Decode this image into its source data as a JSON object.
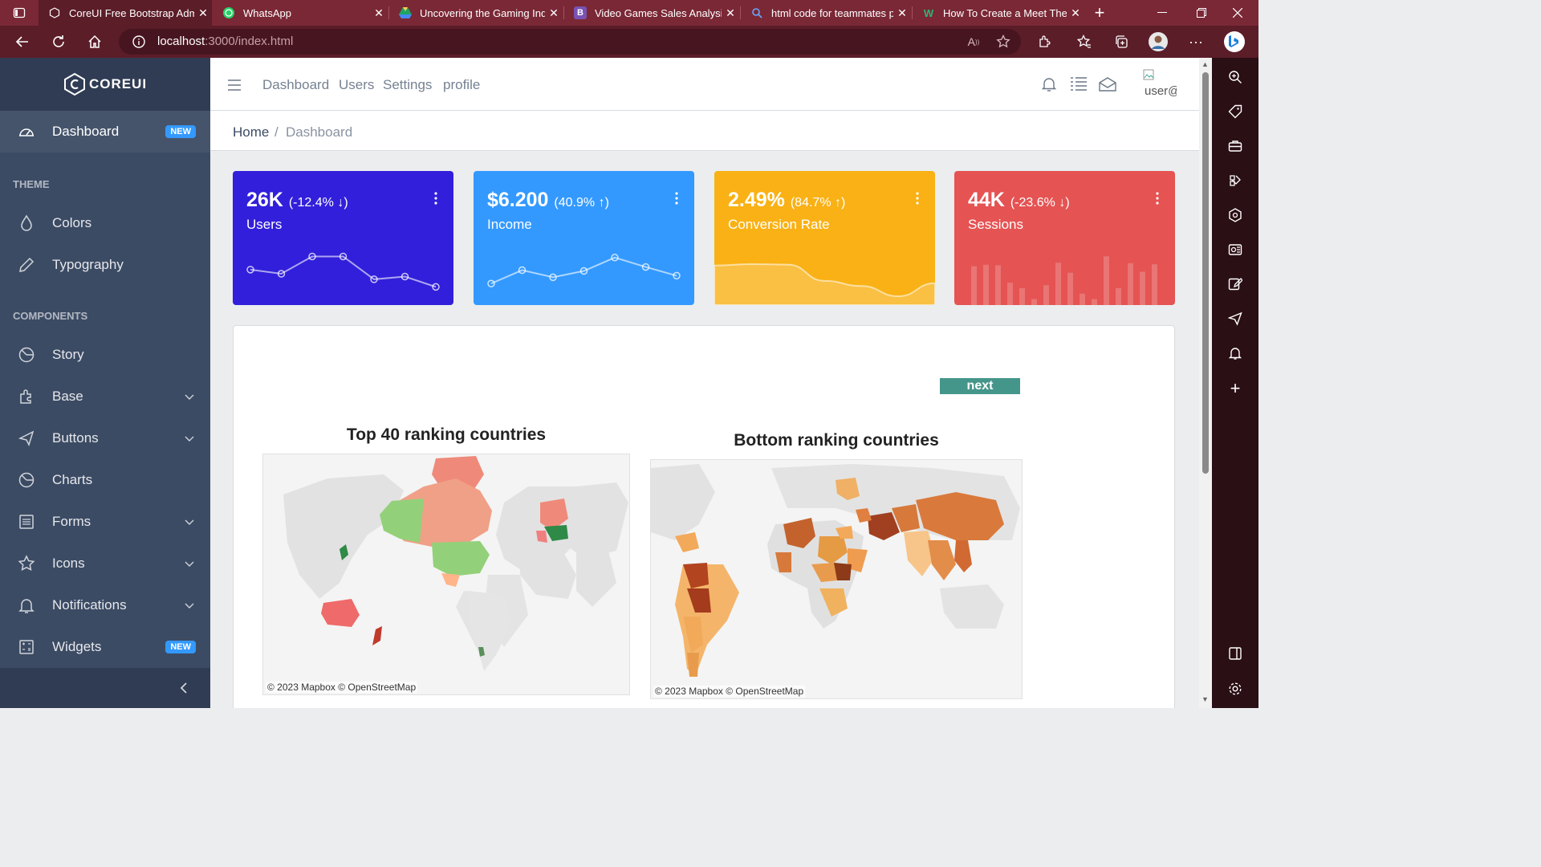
{
  "browser": {
    "tabs": [
      {
        "title": "CoreUI Free Bootstrap Adm",
        "icon": "coreui-favicon-icon",
        "active": true
      },
      {
        "title": "WhatsApp",
        "icon": "whatsapp-icon",
        "active": false
      },
      {
        "title": "Uncovering the Gaming Ind",
        "icon": "drive-icon",
        "active": false
      },
      {
        "title": "Video Games Sales Analysis",
        "icon": "bootstrap-icon",
        "active": false
      },
      {
        "title": "html code for teammates p",
        "icon": "search-icon",
        "active": false
      },
      {
        "title": "How To Create a Meet The",
        "icon": "w-icon",
        "active": false
      }
    ],
    "url_host": "localhost",
    "url_path": ":3000/index.html"
  },
  "sidebar": {
    "brand": "COREUI",
    "dashboard": {
      "label": "Dashboard",
      "badge": "NEW"
    },
    "theme_title": "THEME",
    "theme_items": [
      "Colors",
      "Typography"
    ],
    "components_title": "COMPONENTS",
    "component_items": [
      "Story",
      "Base",
      "Buttons",
      "Charts",
      "Forms",
      "Icons",
      "Notifications"
    ],
    "widgets": {
      "label": "Widgets",
      "badge": "NEW"
    }
  },
  "header": {
    "links": [
      "Dashboard",
      "Users",
      "Settings",
      "profile"
    ],
    "avatar_alt": "user@"
  },
  "breadcrumb": {
    "home": "Home",
    "current": "Dashboard"
  },
  "widgets": [
    {
      "value": "26K",
      "change": "(-12.4%",
      "arrow": "↓",
      "close": ")",
      "label": "Users",
      "color": "#321fdb"
    },
    {
      "value": "$6.200",
      "change": "(40.9%",
      "arrow": "↑",
      "close": ")",
      "label": "Income",
      "color": "#39f"
    },
    {
      "value": "2.49%",
      "change": "(84.7%",
      "arrow": "↑",
      "close": ")",
      "label": "Conversion Rate",
      "color": "#f9b115"
    },
    {
      "value": "44K",
      "change": "(-23.6%",
      "arrow": "↓",
      "close": ")",
      "label": "Sessions",
      "color": "#e55353"
    }
  ],
  "sparklines": {
    "users": [
      65,
      59,
      84,
      84,
      51,
      55,
      40
    ],
    "income": [
      1,
      18,
      9,
      17,
      34,
      22,
      11
    ],
    "conversion": [
      78,
      81,
      80,
      45,
      34,
      12,
      40
    ],
    "sessions": [
      78,
      81,
      80,
      45,
      34,
      12,
      40,
      85,
      65,
      23,
      12,
      98,
      34,
      84,
      67,
      82
    ]
  },
  "card": {
    "next_label": "next",
    "map_left": {
      "title": "Top 40 ranking countries",
      "attribution": "© 2023 Mapbox  © OpenStreetMap"
    },
    "map_right": {
      "title": "Bottom ranking countries",
      "attribution": "© 2023 Mapbox  © OpenStreetMap"
    }
  }
}
